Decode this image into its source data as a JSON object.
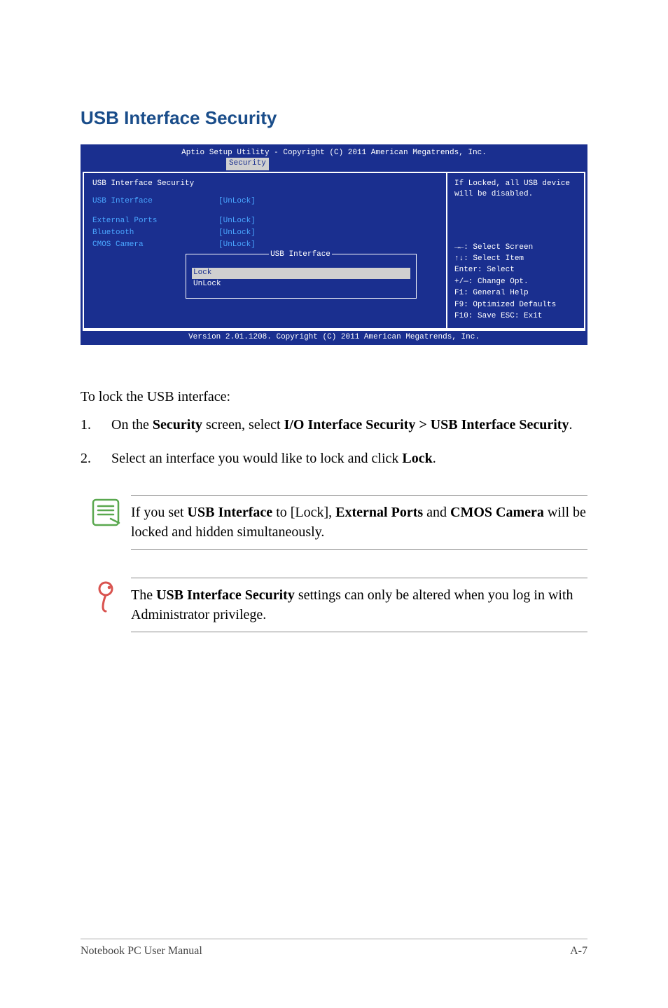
{
  "heading": "USB Interface Security",
  "bios": {
    "titlebar": "Aptio Setup Utility - Copyright (C) 2011 American Megatrends, Inc.",
    "tab": "Security",
    "screen_title": "USB Interface Security",
    "items": [
      {
        "label": "USB Interface",
        "value": "[UnLock]"
      },
      {
        "label": "External Ports",
        "value": "[UnLock]"
      },
      {
        "label": "Bluetooth",
        "value": "[UnLock]"
      },
      {
        "label": "CMOS Camera",
        "value": "[UnLock]"
      }
    ],
    "dialog": {
      "title": "USB Interface",
      "options": [
        "Lock",
        "UnLock"
      ],
      "selected": 0
    },
    "help_top": "If Locked, all USB device will be disabled.",
    "help_keys": [
      "→←: Select Screen",
      "↑↓:   Select Item",
      "Enter: Select",
      "+/—:  Change Opt.",
      "F1:    General Help",
      "F9:    Optimized Defaults",
      "F10:  Save   ESC: Exit"
    ],
    "footer": "Version 2.01.1208. Copyright (C) 2011 American Megatrends, Inc."
  },
  "intro": "To lock the USB interface:",
  "steps": [
    {
      "num": "1.",
      "pre": "On the ",
      "b1": "Security",
      "mid1": " screen, select ",
      "b2": "I/O Interface Security > USB Interface Security",
      "post": "."
    },
    {
      "num": "2.",
      "pre": "Select an interface you would like to lock and click ",
      "b1": "Lock",
      "post": "."
    }
  ],
  "note1": {
    "pre": "If you set ",
    "b1": "USB Interface",
    "mid1": " to [Lock], ",
    "b2": "External Ports",
    "mid2": " and ",
    "b3": "CMOS Camera",
    "post": " will be locked and hidden simultaneously."
  },
  "note2": {
    "pre": "The ",
    "b1": "USB Interface Security",
    "post": " settings can only be altered when you log in with Administrator privilege."
  },
  "footer": {
    "left": "Notebook PC User Manual",
    "right": "A-7"
  }
}
